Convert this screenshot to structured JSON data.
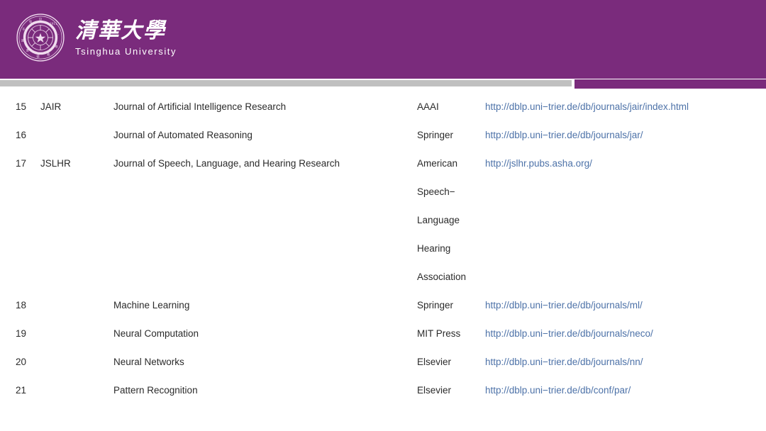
{
  "header": {
    "background_color": "#7a2b7c",
    "logo": {
      "icon": "tsinghua-seal-icon",
      "cn_name": "清華大學",
      "en_name": "Tsinghua University"
    }
  },
  "dividers": {
    "gray_color": "#c0c0c0",
    "purple_color": "#7a2b7c"
  },
  "table": {
    "link_color": "#4d72a8",
    "text_color": "#2b2b2b",
    "rows": [
      {
        "num": "15",
        "abbr": "JAIR",
        "title": "Journal of Artificial Intelligence Research",
        "publisher": "AAAI",
        "url": "http://dblp.uni−trier.de/db/journals/jair/index.html"
      },
      {
        "num": "16",
        "abbr": "",
        "title": "Journal of Automated Reasoning",
        "publisher": "Springer",
        "url": "http://dblp.uni−trier.de/db/journals/jar/"
      },
      {
        "num": "17",
        "abbr": "JSLHR",
        "title": "Journal of Speech, Language, and Hearing Research",
        "publisher": "American",
        "url": "http://jslhr.pubs.asha.org/"
      },
      {
        "num": "",
        "abbr": "",
        "title": "",
        "publisher": "Speech−",
        "url": ""
      },
      {
        "num": "",
        "abbr": "",
        "title": "",
        "publisher": "Language",
        "url": ""
      },
      {
        "num": "",
        "abbr": "",
        "title": "",
        "publisher": "Hearing",
        "url": ""
      },
      {
        "num": "",
        "abbr": "",
        "title": "",
        "publisher": "Association",
        "url": ""
      },
      {
        "num": "18",
        "abbr": "",
        "title": "Machine Learning",
        "publisher": "Springer",
        "url": "http://dblp.uni−trier.de/db/journals/ml/"
      },
      {
        "num": "19",
        "abbr": "",
        "title": "Neural Computation",
        "publisher": "MIT Press",
        "url": "http://dblp.uni−trier.de/db/journals/neco/"
      },
      {
        "num": "20",
        "abbr": "",
        "title": "Neural Networks",
        "publisher": "Elsevier",
        "url": "http://dblp.uni−trier.de/db/journals/nn/"
      },
      {
        "num": "21",
        "abbr": "",
        "title": "Pattern Recognition",
        "publisher": "Elsevier",
        "url": "http://dblp.uni−trier.de/db/conf/par/"
      }
    ]
  }
}
